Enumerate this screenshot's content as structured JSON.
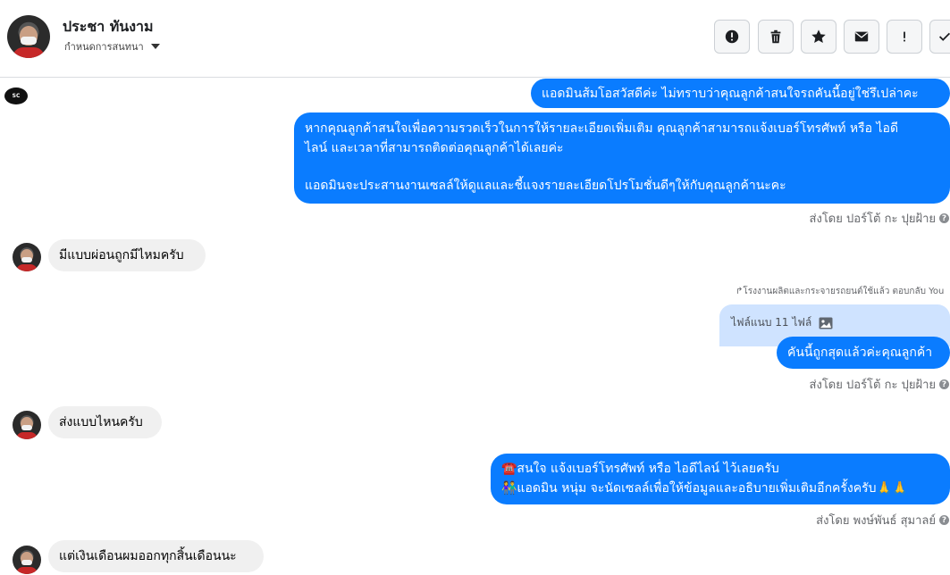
{
  "header": {
    "contact_name": "ประชา ทันงาม",
    "assign_label": "กำหนดการสนทนา",
    "toolbar": [
      "alert-circle-icon",
      "trash-icon",
      "star-icon",
      "envelope-icon",
      "exclamation-icon",
      "check-icon"
    ]
  },
  "page_logo_text": "SC",
  "messages": {
    "m1": "แอดมินส้มโอสวัสดีค่ะ ไม่ทราบว่าคุณลูกค้าสนใจรถคันนี้อยู่ใช่รึเปล่าคะ",
    "m2_line1": "หากคุณลูกค้าสนใจเพื่อความรวดเร็วในการให้รายละเอียดเพิ่มเติม คุณลูกค้าสามารถแจ้งเบอร์โทรศัพท์ หรือ ไอดี",
    "m2_line2": "ไลน์ และเวลาที่สามารถติดต่อคุณลูกค้าได้เลยค่ะ",
    "m2_line3": "แอดมินจะประสานงานเซลล์ให้ดูแลและชี้แจงรายละเอียดโปรโมชั่นดีๆให้กับคุณลูกค้านะคะ",
    "sent_by_1": "ส่งโดย ปอร์โต้ กะ ปุยฝ้าย",
    "in1": "มีแบบผ่อนถูกมีไหมครับ",
    "reply_note": "↱โรงงานผลิตและกระจายรถยนต์ใช้แล้ว ตอบกลับ You",
    "attachment_label": "ไฟล์แนบ 11 ไฟล์",
    "m3": "คันนี้ถูกสุดแล้วค่ะคุณลูกค้า",
    "sent_by_2": "ส่งโดย ปอร์โต้ กะ ปุยฝ้าย",
    "in2": "ส่งแบบไหนครับ",
    "m4_line1": "☎️สนใจ แจ้งเบอร์โทรศัพท์ หรือ ไอดีไลน์  ไว้เลยครับ",
    "m4_line2": "👫แอดมิน หนุ่ม จะนัดเซลล์เพื่อให้ข้อมูลและอธิบายเพิ่มเติมอีกครั้งครับ🙏🙏",
    "sent_by_3": "ส่งโดย พงษ์พันธ์ สุมาลย์",
    "in3": "แต่เงินเดือนผมออกทุกสิ้นเดือนนะ"
  },
  "colors": {
    "outgoing": "#0a7cff",
    "incoming": "#f0f0f0",
    "attachment": "#cfe3ff"
  }
}
